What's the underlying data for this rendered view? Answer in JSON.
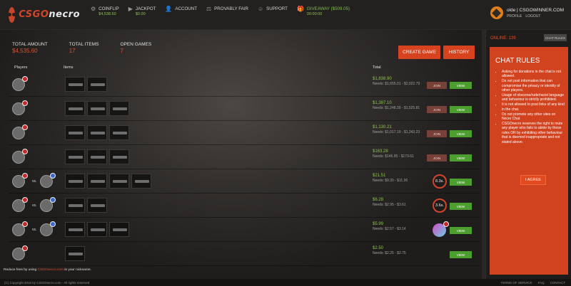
{
  "header": {
    "logo_prefix": "CSGO",
    "logo_suffix": "necro",
    "nav": [
      {
        "icon": "coinflip-icon",
        "glyph": "⚙",
        "label": "COINFLIP",
        "sub": "$4,538.60"
      },
      {
        "icon": "jackpot-icon",
        "glyph": "▶",
        "label": "JACKPOT",
        "sub": "$0.00"
      },
      {
        "icon": "account-icon",
        "glyph": "👤",
        "label": "ACCOUNT",
        "sub": ""
      },
      {
        "icon": "provably-fair-icon",
        "glyph": "⚖",
        "label": "PROVABLY FAIR",
        "sub": ""
      },
      {
        "icon": "support-icon",
        "glyph": "☺",
        "label": "SUPPORT",
        "sub": ""
      },
      {
        "icon": "giveaway-icon",
        "glyph": "🎁",
        "label": "GIVEAWAY ($509.05)",
        "sub": "00:00:00"
      }
    ],
    "user": {
      "name": "olde | CSGOWINNER.COM",
      "links": [
        "PROFILE",
        "LOGOUT"
      ]
    }
  },
  "stats": {
    "total_amount_label": "TOTAL AMOUNT",
    "total_amount": "$4,535.60",
    "total_items_label": "TOTAL ITEMS",
    "total_items": "17",
    "open_games_label": "OPEN GAMES",
    "open_games": "7"
  },
  "buttons": {
    "create_game": "CREATE GAME",
    "history": "HISTORY"
  },
  "columns": {
    "players": "Players",
    "items": "Items",
    "total": "Total"
  },
  "games": [
    {
      "players": 1,
      "items": 2,
      "price": "$1,838.90",
      "needs": "Needs: $1,655.01 - $2,022.79",
      "action": "join"
    },
    {
      "players": 1,
      "items": 3,
      "price": "$1,387.10",
      "needs": "Needs: $1,248.39 - $1,525.81",
      "action": "join"
    },
    {
      "players": 1,
      "items": 3,
      "price": "$1,130.21",
      "needs": "Needs: $1,017.19 - $1,243.23",
      "action": "join"
    },
    {
      "players": 1,
      "items": 3,
      "price": "$163.28",
      "needs": "Needs: $146.95 - $179.61",
      "action": "join"
    },
    {
      "players": 2,
      "items": 4,
      "price": "$21.51",
      "needs": "Needs: $9.30 - $11.36",
      "action": "timer",
      "timer": "8.3s."
    },
    {
      "players": 2,
      "items": 2,
      "price": "$6.28",
      "needs": "Needs: $2.95 - $3.61",
      "action": "timer",
      "timer": "3.6s."
    },
    {
      "players": 2,
      "items": 3,
      "price": "$5.99",
      "needs": "Needs: $2.57 - $3.14",
      "action": "winner"
    },
    {
      "players": 1,
      "items": 1,
      "price": "$2.50",
      "needs": "Needs: $2.25 - $2.75",
      "action": "view"
    }
  ],
  "row_labels": {
    "join": "JOIN",
    "view": "VIEW",
    "vs": "vs."
  },
  "sidebar": {
    "online": "ONLINE: 139",
    "chat_rules_button": "CHAT RULES",
    "chat_title": "CHAT RULES",
    "rules": [
      "Asking for donations in the chat is not allowed.",
      "Do not post information that can compromise the privacy or identity of other players.",
      "Usage of obscene/rude/racist language and behaviour is strictly prohibited.",
      "It is not allowed to post links of any kind in the chat.",
      "Do not promote any other sites on Necro Chat",
      "CSGOnecro reserves the right to mute any player who fails to abide by these rules OR by exhibiting other behaviour that is deemed inappropriate and not stated above."
    ],
    "agree": "I AGREE"
  },
  "footer": {
    "note_prefix": "Reduce fees by using",
    "note_link": "CSGOnecro.com",
    "note_suffix": "in your nickname.",
    "copyright": "(C) Copyright 2016 by CSGOnecro.com - All rights reserved",
    "links": [
      "TERMS OF SERVICE",
      "FAQ",
      "CONTACT"
    ]
  }
}
